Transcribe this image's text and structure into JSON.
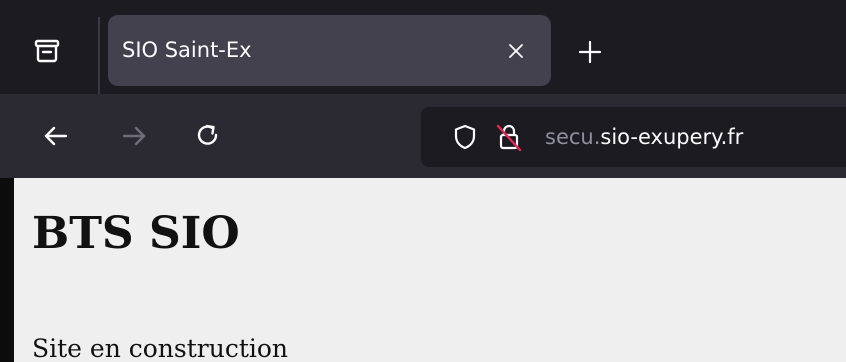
{
  "browser": {
    "tabs": [
      {
        "title": "SIO Saint-Ex",
        "active": true
      }
    ],
    "icons": {
      "tab_list": "tab-list-icon",
      "close_tab": "close-icon",
      "new_tab": "plus-icon",
      "back": "arrow-left-icon",
      "forward": "arrow-right-icon",
      "reload": "reload-icon",
      "tracking_protection": "shield-icon",
      "connection_insecure": "lock-insecure-icon"
    },
    "url": {
      "prefix": "secu.",
      "domain": "sio-exupery.fr"
    }
  },
  "page": {
    "heading": "BTS SIO",
    "body_text": "Site en construction"
  },
  "colors": {
    "chrome_dark": "#1c1b22",
    "toolbar": "#2b2a33",
    "active_tab": "#42414d",
    "icon": "#fbfbfe",
    "icon_disabled": "#6e6d77",
    "insecure_accent": "#e22850",
    "content_bg": "#efefef"
  }
}
